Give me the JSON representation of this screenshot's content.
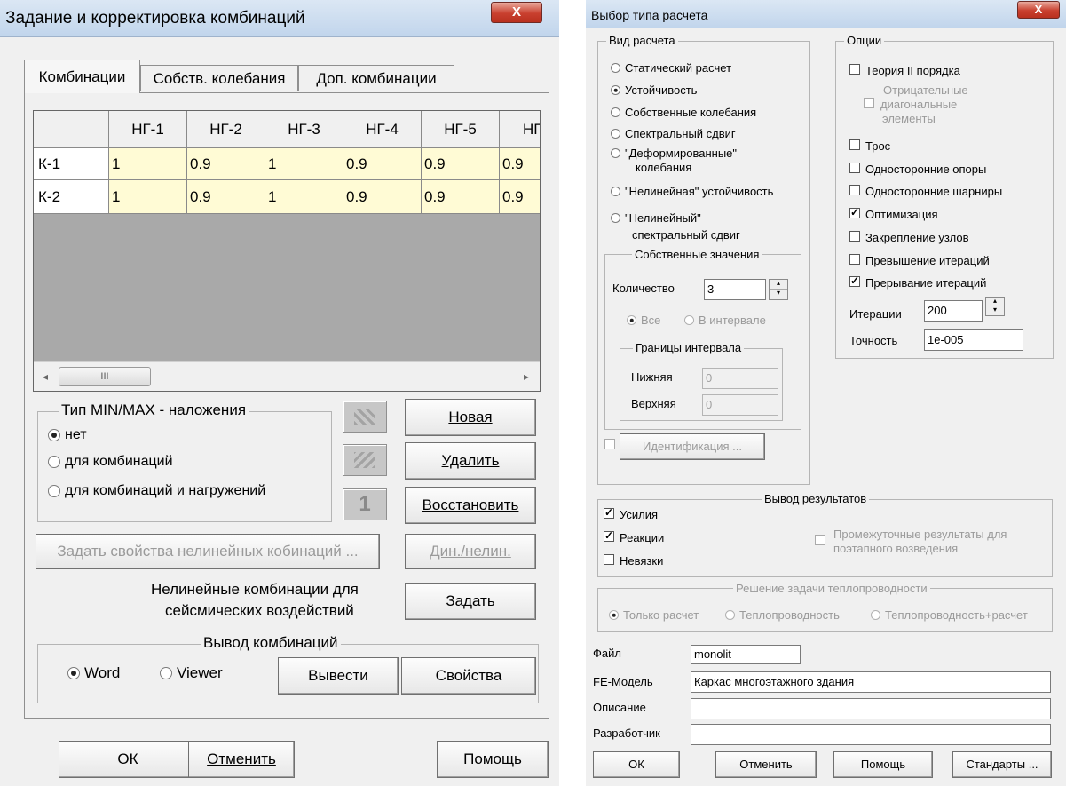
{
  "left_dialog": {
    "title": "Задание и корректировка комбинаций",
    "close_label": "X",
    "tabs": [
      "Комбинации",
      "Собств. колебания",
      "Доп. комбинации"
    ],
    "table": {
      "columns": [
        "НГ-1",
        "НГ-2",
        "НГ-3",
        "НГ-4",
        "НГ-5",
        "НГ-"
      ],
      "rows": [
        {
          "label": "К-1",
          "values": [
            "1",
            "0.9",
            "1",
            "0.9",
            "0.9",
            "0.9"
          ]
        },
        {
          "label": "К-2",
          "values": [
            "1",
            "0.9",
            "1",
            "0.9",
            "0.9",
            "0.9"
          ]
        }
      ],
      "scroll_thumb_label": "III",
      "arrow_left": "◂",
      "arrow_right": "▸"
    },
    "overlay_group": {
      "title": "Тип  MIN/MAX - наложения",
      "options": [
        "нет",
        "для комбинаций",
        "для комбинаций и нагружений"
      ],
      "selected": 0
    },
    "icon_buttons": {
      "restore_glyph": "1"
    },
    "buttons": {
      "new": "Новая",
      "delete": "Удалить",
      "restore": "Восстановить",
      "nonlinear_props": "Задать свойства нелинейных кобинаций ...",
      "dyn_nonlin": "Дин./нелин.",
      "set": "Задать",
      "export": "Вывести",
      "properties": "Свойства",
      "ok": "ОК",
      "cancel": "Отменить",
      "help": "Помощь"
    },
    "nonlinear_text_1": "Нелинейные комбинации для",
    "nonlinear_text_2": "сейсмических воздействий",
    "output_group": {
      "title": "Вывод  комбинаций",
      "options": [
        "Word",
        "Viewer"
      ],
      "selected": 0
    }
  },
  "right_dialog": {
    "title": "Выбор типа расчета",
    "close_label": "X",
    "calc_type": {
      "title": "Вид расчета",
      "options": [
        "Статический расчет",
        "Устойчивость",
        "Собственные колебания",
        "Спектральный сдвиг",
        "\"Деформированные\"",
        "колебания",
        "\"Нелинейная\" устойчивость",
        "\"Нелинейный\"",
        "спектральный  сдвиг"
      ],
      "selected": 1
    },
    "eigen": {
      "title": "Собственные значения",
      "count_label": "Количество",
      "count_value": "3",
      "all_label": "Все",
      "range_label": "В интервале",
      "bounds_title": "Границы интервала",
      "lower_label": "Нижняя",
      "lower_value": "0",
      "upper_label": "Верхняя",
      "upper_value": "0"
    },
    "identification": "Идентификация ...",
    "options": {
      "title": "Опции",
      "theory2": {
        "label": "Теория II порядка",
        "checked": false
      },
      "negative": {
        "line1": "Отрицательные",
        "line2": "диагональные",
        "line3": "элементы",
        "checked": false
      },
      "cable": {
        "label": "Трос",
        "checked": false
      },
      "one_side_supports": {
        "label": "Односторонние опоры",
        "checked": false
      },
      "one_side_hinges": {
        "label": "Односторонние шарниры",
        "checked": false
      },
      "optimization": {
        "label": "Оптимизация",
        "checked": true
      },
      "node_fixing": {
        "label": "Закрепление узлов",
        "checked": false
      },
      "iter_exceed": {
        "label": "Превышение итераций",
        "checked": false
      },
      "iter_break": {
        "label": "Прерывание итераций",
        "checked": true
      },
      "iterations_label": "Итерации",
      "iterations_value": "200",
      "precision_label": "Точность",
      "precision_value": "1e-005"
    },
    "results": {
      "title": "Вывод результатов",
      "forces": {
        "label": "Усилия",
        "checked": true
      },
      "reactions": {
        "label": "Реакции",
        "checked": true
      },
      "residuals": {
        "label": "Невязки",
        "checked": false
      },
      "intermediate_1": "Промежуточные результаты для",
      "intermediate_2": "поэтапного возведения"
    },
    "heat": {
      "title": "Решение задачи теплопроводности",
      "options": [
        "Только расчет",
        "Теплопроводность",
        "Теплопроводность+расчет"
      ],
      "selected": 0
    },
    "fields": {
      "file_label": "Файл",
      "file_value": "monolit",
      "model_label": "FE-Модель",
      "model_value": "Каркас многоэтажного здания",
      "desc_label": "Описание",
      "desc_value": "",
      "dev_label": "Разработчик",
      "dev_value": ""
    },
    "buttons": {
      "ok": "ОК",
      "cancel": "Отменить",
      "help": "Помощь",
      "standards": "Стандарты ..."
    }
  }
}
